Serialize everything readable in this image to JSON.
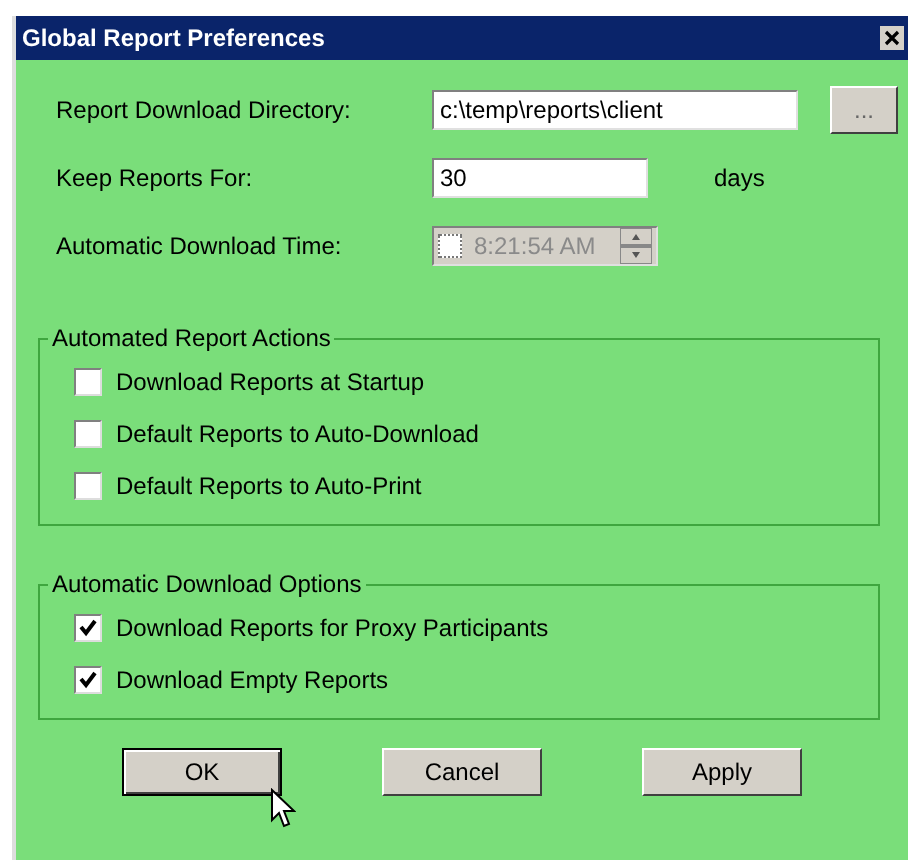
{
  "window": {
    "title": "Global Report Preferences"
  },
  "fields": [
    {
      "kind": "path",
      "label": "Report Download Directory:",
      "value": "c:\\temp\\reports\\client",
      "button": "..."
    },
    {
      "kind": "number",
      "label": "Keep Reports For:",
      "value": "30",
      "unit": "days"
    },
    {
      "kind": "time",
      "label": "Automatic Download Time:",
      "value": "8:21:54 AM",
      "disabled": true,
      "checked": false
    }
  ],
  "groups": [
    {
      "title": "Automated Report Actions",
      "options": [
        {
          "label": "Download Reports at Startup",
          "checked": false
        },
        {
          "label": "Default Reports to Auto-Download",
          "checked": false
        },
        {
          "label": "Default Reports to Auto-Print",
          "checked": false
        }
      ]
    },
    {
      "title": "Automatic Download Options",
      "options": [
        {
          "label": "Download Reports for Proxy Participants",
          "checked": true
        },
        {
          "label": "Download Empty Reports",
          "checked": true
        }
      ]
    }
  ],
  "buttons": [
    {
      "label": "OK",
      "default": true
    },
    {
      "label": "Cancel",
      "default": false
    },
    {
      "label": "Apply",
      "default": false
    }
  ]
}
